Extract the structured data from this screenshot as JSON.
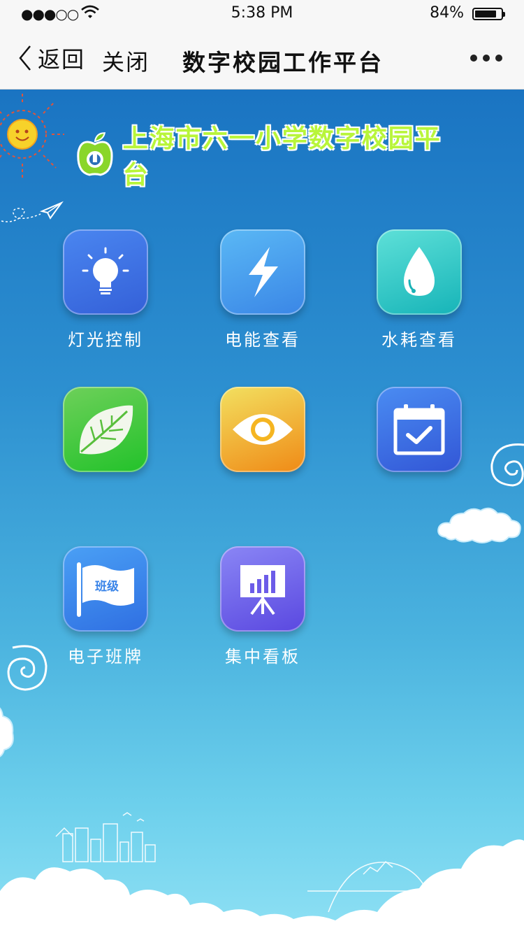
{
  "status_bar": {
    "signal": "●●●○○",
    "time": "5:38 PM",
    "battery_percent": "84%",
    "battery_level": 0.84
  },
  "navbar": {
    "back_label": "返回",
    "close_label": "关闭",
    "title": "数字校园工作平台",
    "more_icon": "more-dots-icon"
  },
  "banner": {
    "title": "上海市六一小学数字校园平台",
    "logo_icon": "apple-logo-icon"
  },
  "tiles": [
    {
      "label": "灯光控制",
      "icon": "lightbulb-icon",
      "color_from": "#4a86f0",
      "color_to": "#3460d8"
    },
    {
      "label": "电能查看",
      "icon": "lightning-icon",
      "color_from": "#5ab8f5",
      "color_to": "#3a86e6"
    },
    {
      "label": "水耗查看",
      "icon": "water-drop-icon",
      "color_from": "#5ee0d8",
      "color_to": "#16b4b8"
    },
    {
      "label": "",
      "icon": "leaf-icon",
      "color_from": "#6ed05a",
      "color_to": "#22c22a"
    },
    {
      "label": "",
      "icon": "eye-icon",
      "color_from": "#f2e060",
      "color_to": "#f08a16"
    },
    {
      "label": "",
      "icon": "calendar-check-icon",
      "color_from": "#4a8cf2",
      "color_to": "#3256d6"
    },
    {
      "label": "电子班牌",
      "icon": "class-flag-icon",
      "flag_text": "班级",
      "color_from": "#4aa0f5",
      "color_to": "#2f6fe2"
    },
    {
      "label": "集中看板",
      "icon": "presentation-board-icon",
      "color_from": "#8a86f5",
      "color_to": "#5a48e0"
    }
  ]
}
